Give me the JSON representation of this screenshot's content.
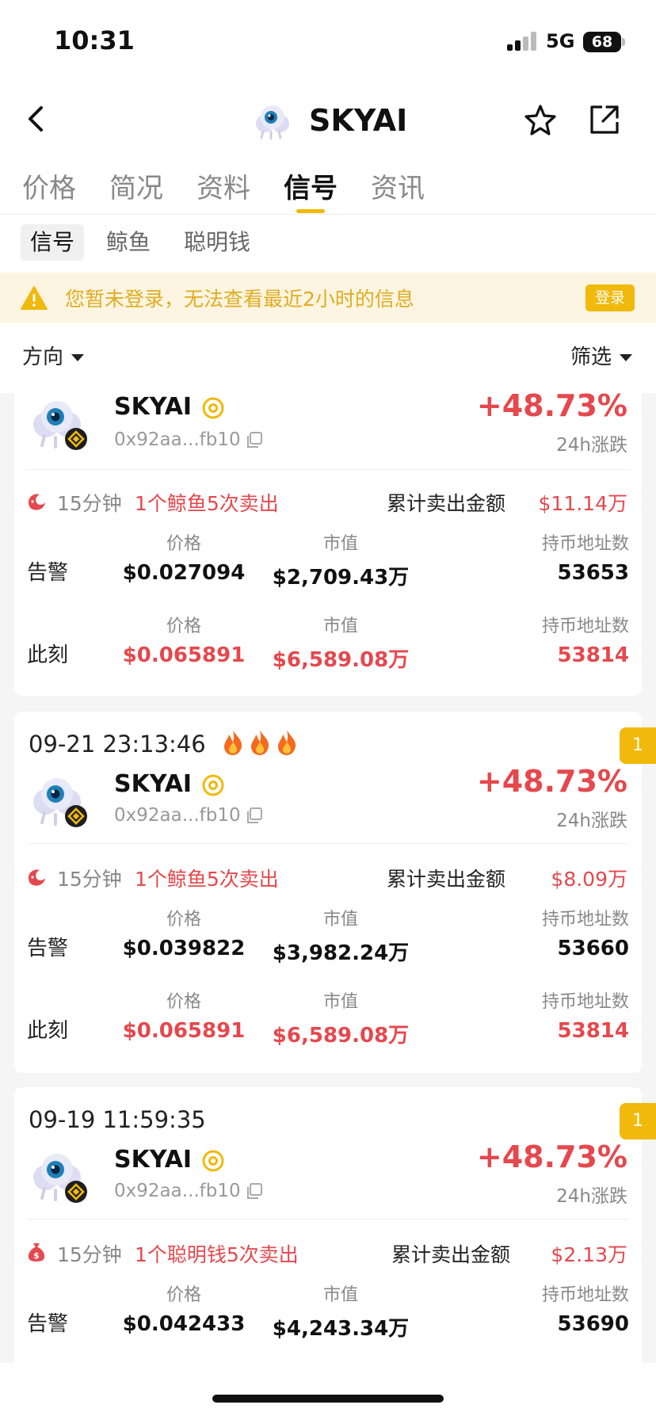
{
  "status": {
    "time": "10:31",
    "network": "5G",
    "battery": "68"
  },
  "header": {
    "title": "SKYAI"
  },
  "tabs": [
    "价格",
    "简况",
    "资料",
    "信号",
    "资讯"
  ],
  "subtabs": [
    "信号",
    "鲸鱼",
    "聪明钱"
  ],
  "banner": {
    "text": "您暂未登录，无法查看最近2小时的信息",
    "button": "登录"
  },
  "filters": {
    "left": "方向",
    "right": "筛选"
  },
  "labels": {
    "price": "价格",
    "mcap": "市值",
    "holders": "持币地址数",
    "alert": "告警",
    "now": "此刻",
    "change_label": "24h涨跌",
    "sum_sell": "累计卖出金额"
  },
  "cards": [
    {
      "token": "SKYAI",
      "address": "0x92aa...fb10",
      "change": "+48.73%",
      "period": "15分钟",
      "signal": "1个鲸鱼5次卖出",
      "sum": "$11.14万",
      "alert": {
        "price": "$0.027094",
        "mcap": "$2,709.43万",
        "holders": "53653"
      },
      "now": {
        "price": "$0.065891",
        "mcap": "$6,589.08万",
        "holders": "53814"
      }
    },
    {
      "time": "09-21 23:13:46",
      "badge": "1",
      "token": "SKYAI",
      "address": "0x92aa...fb10",
      "change": "+48.73%",
      "period": "15分钟",
      "signal": "1个鲸鱼5次卖出",
      "sum": "$8.09万",
      "alert": {
        "price": "$0.039822",
        "mcap": "$3,982.24万",
        "holders": "53660"
      },
      "now": {
        "price": "$0.065891",
        "mcap": "$6,589.08万",
        "holders": "53814"
      }
    },
    {
      "time": "09-19 11:59:35",
      "badge": "1",
      "token": "SKYAI",
      "address": "0x92aa...fb10",
      "change": "+48.73%",
      "period": "15分钟",
      "signal": "1个聪明钱5次卖出",
      "sum": "$2.13万",
      "alert": {
        "price": "$0.042433",
        "mcap": "$4,243.34万",
        "holders": "53690"
      }
    }
  ],
  "icons": {
    "back": "chevron-left-icon",
    "star": "star-outline-icon",
    "share": "share-out-icon",
    "warning": "warning-triangle-icon",
    "copy": "copy-icon",
    "whale": "whale-icon",
    "smart_money": "money-bag-icon",
    "fire": "fire-icon",
    "at": "at-sign-icon",
    "chain": "bnb-chain-icon"
  },
  "colors": {
    "accent": "#f0b90b",
    "red": "#e5484d",
    "warning_bg": "#fdf5e1"
  }
}
